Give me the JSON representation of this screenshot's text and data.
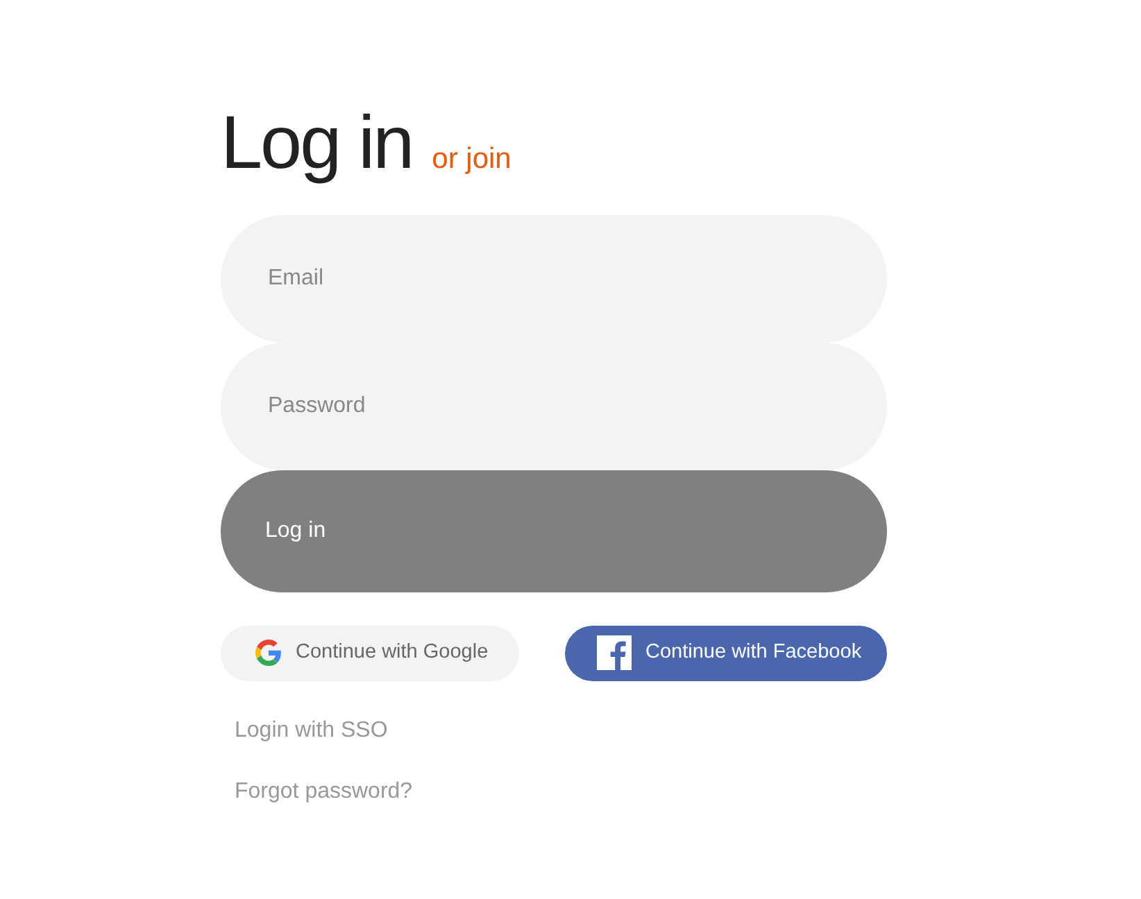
{
  "heading": {
    "title": "Log in",
    "join_link": "or join"
  },
  "fields": [
    {
      "placeholder": "Email"
    },
    {
      "placeholder": "Password"
    }
  ],
  "submit_button": "Log in",
  "social_buttons": [
    {
      "kind": "google",
      "label": "Continue with Google"
    },
    {
      "kind": "facebook",
      "label": "Continue with Facebook"
    }
  ],
  "links": [
    "Login with SSO",
    "Forgot password?"
  ]
}
